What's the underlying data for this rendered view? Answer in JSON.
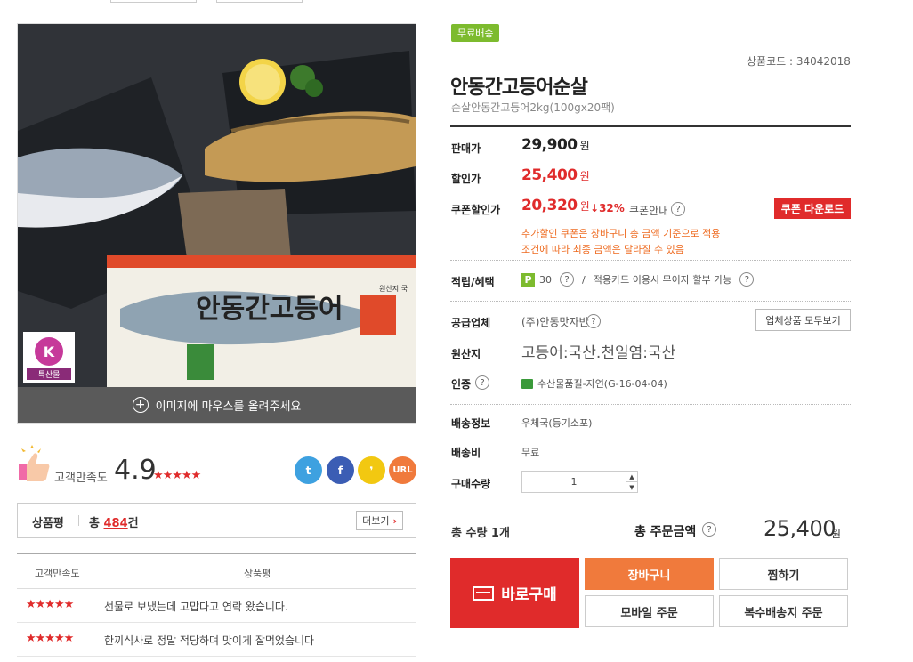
{
  "image": {
    "hover_hint": "이미지에 마우스를 올려주세요",
    "package_text": "안동간고등어",
    "brand_badge": "K",
    "brand_badge_sub": "특산물",
    "package_side_tag": "원산지:국"
  },
  "satisfaction": {
    "label": "고객만족도",
    "score": "4.9",
    "stars": "★★★★★"
  },
  "share": {
    "twitter": "t",
    "facebook": "f",
    "kakao": "❜",
    "url": "URL"
  },
  "reviews": {
    "title": "상품평",
    "total_prefix": "총",
    "count": "484",
    "count_suffix": "건",
    "more_label": "더보기",
    "col_rating": "고객만족도",
    "col_review": "상품평",
    "rows": [
      {
        "stars": "★★★★★",
        "text": "선물로 보냈는데 고맙다고 연락 왔습니다."
      },
      {
        "stars": "★★★★★",
        "text": "한끼식사로 정말 적당하며 맛이게 잘먹었습니다"
      }
    ]
  },
  "product": {
    "badge": "무료배송",
    "code_label": "상품코드 : 34042018",
    "title": "안동간고등어순살",
    "subtitle": "순살안동간고등어2kg(100gx20팩)"
  },
  "pricing": {
    "sale_label": "판매가",
    "sale_price": "29,900",
    "discount_label": "할인가",
    "discount_price": "25,400",
    "coupon_label": "쿠폰할인가",
    "coupon_price": "20,320",
    "coupon_rate": "32%",
    "coupon_info": "쿠폰안내",
    "coupon_button": "쿠폰 다운로드",
    "won": "원",
    "note_1": "추가할인 쿠폰은 장바구니 총 금액 기준으로 적용",
    "note_2": "조건에 따라 최종 금액은 달라질 수 있음"
  },
  "benefits": {
    "label": "적립/혜택",
    "points_badge": "P",
    "points": "30",
    "separator": "/",
    "card_text": "적용카드 이용시 무이자 할부 가능"
  },
  "vendor": {
    "label": "공급업체",
    "name": "(주)안동맛자반",
    "button": "업체상품 모두보기"
  },
  "origin": {
    "label": "원산지",
    "value": "고등어:국산.천일염:국산"
  },
  "certification": {
    "label": "인증",
    "value": "수산물품질-자연(G-16-04-04)"
  },
  "shipping": {
    "info_label": "배송정보",
    "info_value": "우체국(등기소포)",
    "fee_label": "배송비",
    "fee_value": "무료",
    "qty_label": "구매수량",
    "qty_value": "1",
    "qty_up": "▲",
    "qty_down": "▼"
  },
  "totals": {
    "qty_label": "총 수량 1개",
    "amount_label": "총 주문금액",
    "amount": "25,400",
    "won": "원"
  },
  "actions": {
    "buy_now": "바로구매",
    "cart": "장바구니",
    "wishlist": "찜하기",
    "mobile_order": "모바일 주문",
    "multi_delivery": "복수배송지 주문"
  },
  "colors": {
    "accent_red": "#e02b2b",
    "free_ship_green": "#7dbb2e",
    "cart_orange": "#f07a3c"
  }
}
